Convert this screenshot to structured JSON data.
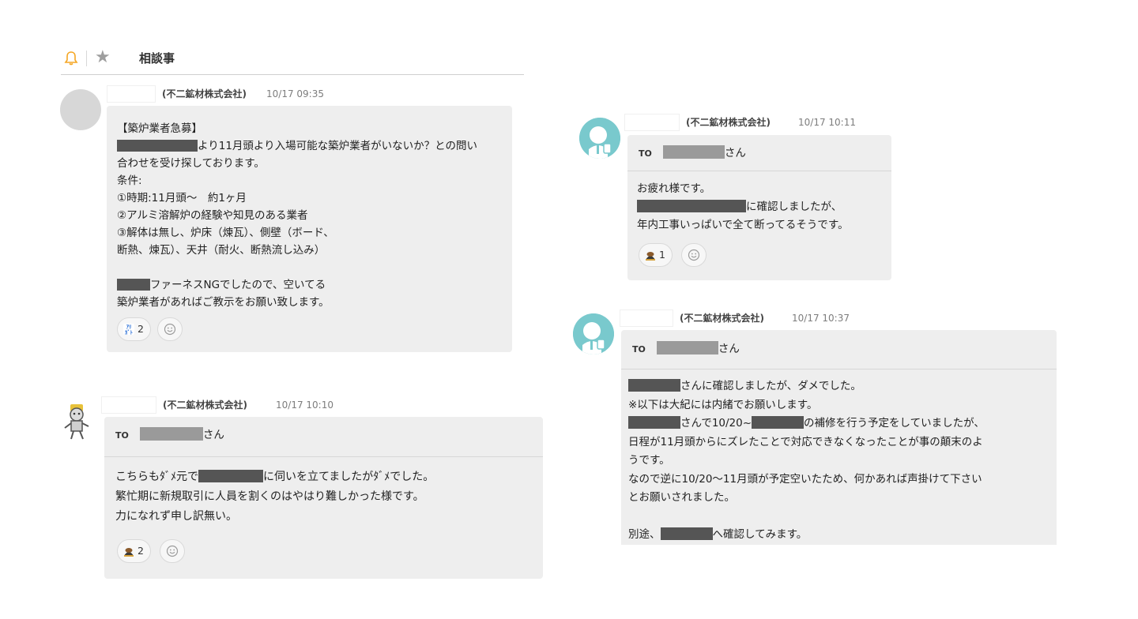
{
  "header": {
    "title": "相談事"
  },
  "messages": {
    "m1": {
      "org": "(不二鉱材株式会社)",
      "time": "10/17 09:35",
      "lines": {
        "l1": "【築炉業者急募】",
        "l2": "より11月頭より入場可能な築炉業者がいないか？との問い",
        "l3": "合わせを受け探しております。",
        "l4": "条件:",
        "l5": "①時期:11月頭～　約1ヶ月",
        "l6": "②アルミ溶解炉の経験や知見のある業者",
        "l7": "③解体は無し、炉床（煉瓦）、側壁（ボード、",
        "l8": "断熱、煉瓦）、天井（耐火、断熱流し込み）",
        "l10": "ファーネスNGでしたので、空いてる",
        "l11": "築炉業者があればご教示をお願い致します。"
      },
      "reaction": {
        "count": "2",
        "icon": "please-reaction-icon"
      }
    },
    "m2": {
      "org": "(不二鉱材株式会社)",
      "time": "10/17 10:10",
      "to_tag": "TO",
      "to_suffix": "さん",
      "lines": {
        "l1a": "こちらもﾀﾞﾒ元で",
        "l1b": "に伺いを立てましたがﾀﾞﾒでした。",
        "l2": "繁忙期に新規取引に人員を割くのはやはり難しかった様です。",
        "l3": "力になれず申し訳無い。"
      },
      "reaction": {
        "count": "2",
        "icon": "bow-reaction-icon"
      }
    },
    "m3": {
      "org": "(不二鉱材株式会社)",
      "time": "10/17 10:11",
      "to_tag": "TO",
      "to_suffix": "さん",
      "lines": {
        "l1": "お疲れ様です。",
        "l2": "に確認しましたが、",
        "l3": "年内工事いっぱいで全て断ってるそうです。"
      },
      "reaction": {
        "count": "1",
        "icon": "bow-reaction-icon"
      }
    },
    "m4": {
      "org": "(不二鉱材株式会社)",
      "time": "10/17 10:37",
      "to_tag": "TO",
      "to_suffix": "さん",
      "lines": {
        "l1": "さんに確認しましたが、ダメでした。",
        "l2": "※以下は大紀には内緒でお願いします。",
        "l3a": "さんで10/20~",
        "l3b": "の補修を行う予定をしていましたが、",
        "l4": "日程が11月頭からにズレたことで対応できなくなったことが事の顛末のよ",
        "l5": "うです。",
        "l6": "なので逆に10/20～11月頭が予定空いたため、何かあれば声掛けて下さい",
        "l7": "とお願いされました。",
        "l9a": "別途、",
        "l9b": "へ確認してみます。"
      }
    }
  },
  "colors": {
    "bubble": "#eeeeee",
    "bell": "#f5a623",
    "avatar_teal": "#79c9cd",
    "redaction": "#555555"
  }
}
